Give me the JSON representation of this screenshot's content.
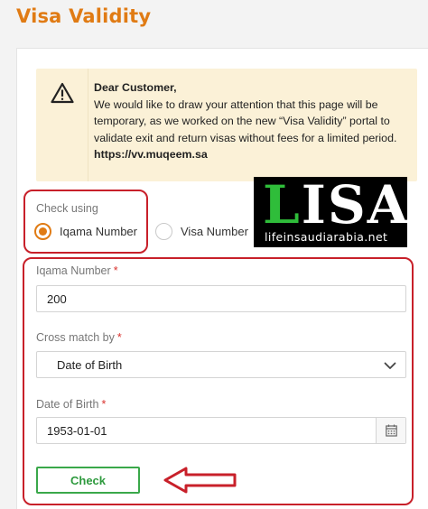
{
  "page": {
    "title": "Visa Validity",
    "accent_color": "#e07b14"
  },
  "notice": {
    "icon": "warning-icon",
    "heading": "Dear Customer,",
    "body": "We would like to draw your attention that this page will be temporary, as we worked on the new “Visa Validity” portal to validate exit and return visas without fees for a limited period.",
    "link": "https://vv.muqeem.sa"
  },
  "check_using": {
    "label": "Check using",
    "options": [
      {
        "label": "Iqama Number",
        "selected": true
      },
      {
        "label": "Visa Number",
        "selected": false
      }
    ]
  },
  "form": {
    "iqama": {
      "label": "Iqama Number",
      "required": "*",
      "value": "200"
    },
    "cross_match": {
      "label": "Cross match by",
      "required": "*",
      "value": "Date of Birth"
    },
    "dob": {
      "label": "Date of Birth",
      "required": "*",
      "value": "1953-01-01",
      "icon": "calendar-icon"
    },
    "submit_label": "Check"
  },
  "watermark": {
    "logo_text_first": "L",
    "logo_text_rest": "ISA",
    "site": "lifeinsaudiarabia.net",
    "logo_green": "#2fbd3a"
  },
  "annotation": {
    "arrow_color": "#c8202a"
  }
}
